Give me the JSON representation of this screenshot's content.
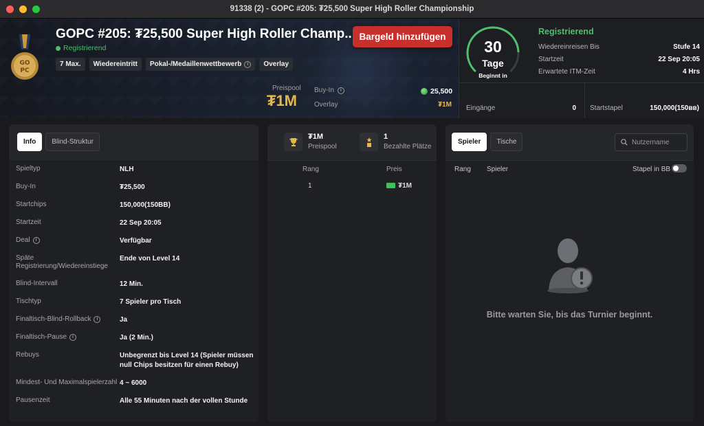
{
  "window": {
    "title": "91338 (2) - GOPC #205: ₮25,500 Super High Roller Championship"
  },
  "header": {
    "title": "GOPC #205: ₮25,500 Super High Roller Champ...",
    "status": "Registrierend",
    "tags": [
      "7 Max.",
      "Wiedereintritt",
      "Pokal-/Medaillenwettbewerb",
      "Overlay"
    ],
    "cash_button": "Bargeld hinzufügen",
    "prizepool_label": "Preispool",
    "prizepool_value": "₮1M",
    "buyin_label": "Buy-In",
    "buyin_value": "25,500",
    "overlay_label": "Overlay",
    "overlay_value": "₮1M"
  },
  "registration": {
    "countdown_number": "30",
    "countdown_unit": "Tage",
    "countdown_sub": "Beginnt in",
    "countdown_progress": 0.82,
    "title": "Registrierend",
    "rows": [
      {
        "label": "Wiedereinreisen Bis",
        "value": "Stufe 14"
      },
      {
        "label": "Startzeit",
        "value": "22 Sep 20:05"
      },
      {
        "label": "Erwartete ITM-Zeit",
        "value": "4 Hrs"
      }
    ],
    "entries_label": "Eingänge",
    "entries_value": "0",
    "stack_label": "Startstapel",
    "stack_value": "150,000(150ʙʙ)"
  },
  "info_panel": {
    "tabs": [
      "Info",
      "Blind-Struktur"
    ],
    "rows": [
      {
        "label": "Spieltyp",
        "value": "NLH",
        "info": false
      },
      {
        "label": "Buy-In",
        "value": "₮25,500",
        "info": false
      },
      {
        "label": "Startchips",
        "value": "150,000(150BB)",
        "info": false
      },
      {
        "label": "Startzeit",
        "value": "22 Sep 20:05",
        "info": false
      },
      {
        "label": "Deal",
        "value": "Verfügbar",
        "info": true
      },
      {
        "label": "Späte Registrierung/Wiedereinstiege",
        "value": "Ende von Level 14",
        "info": false
      },
      {
        "label": "Blind-Intervall",
        "value": "12 Min.",
        "info": false
      },
      {
        "label": "Tischtyp",
        "value": "7 Spieler pro Tisch",
        "info": false
      },
      {
        "label": "Finaltisch-Blind-Rollback",
        "value": "Ja",
        "info": true
      },
      {
        "label": "Finaltisch-Pause",
        "value": "Ja (2 Min.)",
        "info": true
      },
      {
        "label": "Rebuys",
        "value": "Unbegrenzt bis Level 14 (Spieler müssen null Chips besitzen für einen Rebuy)",
        "info": false
      },
      {
        "label": "Mindest- Und Maximalspielerzahl",
        "value": "4 ~ 6000",
        "info": false
      },
      {
        "label": "Pausenzeit",
        "value": "Alle 55 Minuten nach der vollen Stunde",
        "info": false
      }
    ]
  },
  "prizes_panel": {
    "prizepool_value": "₮1M",
    "prizepool_label": "Preispool",
    "paid_value": "1",
    "paid_label": "Bezahlte Plätze",
    "col_rank": "Rang",
    "col_prize": "Preis",
    "rows": [
      {
        "rank": "1",
        "prize": "₮1M"
      }
    ]
  },
  "players_panel": {
    "tabs": [
      "Spieler",
      "Tische"
    ],
    "search_placeholder": "Nutzername",
    "col_rank": "Rang",
    "col_player": "Spieler",
    "col_stack": "Stapel in BB",
    "empty_message": "Bitte warten Sie, bis das Turnier beginnt."
  },
  "colors": {
    "accent_green": "#4cbf6e",
    "gold": "#e6b84a",
    "cta_red": "#c8302c"
  }
}
